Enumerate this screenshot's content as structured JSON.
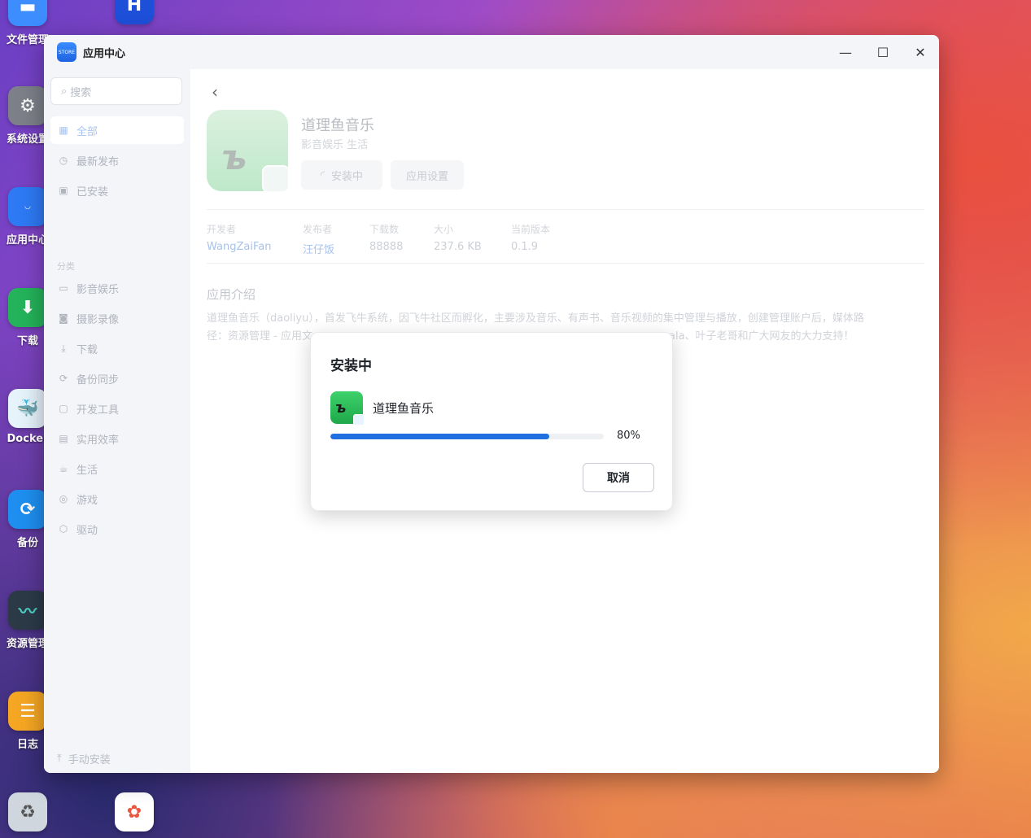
{
  "desktop": {
    "icons": [
      {
        "label": "文件管理",
        "color": "#3d8dff"
      },
      {
        "label": "系统设置",
        "color": "#7d8089"
      },
      {
        "label": "应用中心",
        "color": "#2e7af5"
      },
      {
        "label": "下载",
        "color": "#24b35a"
      },
      {
        "label": "Docker",
        "color": "#3f9ad8"
      },
      {
        "label": "备份",
        "color": "#1e8ff0"
      },
      {
        "label": "资源管理",
        "color": "#2c3a48"
      },
      {
        "label": "日志",
        "color": "#f5a623"
      },
      {
        "label": "",
        "color": "#cfd6de"
      },
      {
        "label": "",
        "color": "#ffffff"
      },
      {
        "label": "",
        "color": "#1d4fd8"
      }
    ]
  },
  "window": {
    "title": "应用中心",
    "icon_text": "STORE",
    "controls": {
      "minimize": "—",
      "maximize": "☐",
      "close": "✕"
    }
  },
  "sidebar": {
    "search_placeholder": "搜索",
    "items": [
      {
        "label": "全部",
        "icon": "grid-icon",
        "glyph": "▦"
      },
      {
        "label": "最新发布",
        "icon": "clock-icon",
        "glyph": "◷"
      },
      {
        "label": "已安装",
        "icon": "installed-icon",
        "glyph": "▣"
      }
    ],
    "category_label": "分类",
    "categories": [
      {
        "label": "影音娱乐",
        "icon": "video-icon",
        "glyph": "▭"
      },
      {
        "label": "摄影录像",
        "icon": "camera-icon",
        "glyph": "◙"
      },
      {
        "label": "下载",
        "icon": "download-icon",
        "glyph": "⤓"
      },
      {
        "label": "备份同步",
        "icon": "sync-icon",
        "glyph": "⟳"
      },
      {
        "label": "开发工具",
        "icon": "code-icon",
        "glyph": "▢"
      },
      {
        "label": "实用效率",
        "icon": "briefcase-icon",
        "glyph": "▤"
      },
      {
        "label": "生活",
        "icon": "cup-icon",
        "glyph": "☕"
      },
      {
        "label": "游戏",
        "icon": "gamepad-icon",
        "glyph": "◎"
      },
      {
        "label": "驱动",
        "icon": "cube-icon",
        "glyph": "⬡"
      }
    ],
    "manual_install": "手动安装"
  },
  "app": {
    "name": "道理鱼音乐",
    "tags": "影音娱乐 生活",
    "install_button": "安装中",
    "settings_button": "应用设置",
    "meta": {
      "developer_label": "开发者",
      "developer": "WangZaiFan",
      "publisher_label": "发布者",
      "publisher": "汪仔饭",
      "downloads_label": "下载数",
      "downloads": "88888",
      "size_label": "大小",
      "size": "237.6 KB",
      "version_label": "当前版本",
      "version": "0.1.9"
    },
    "intro_title": "应用介绍",
    "intro_text_line1": "道理鱼音乐（daoliyu），首发飞牛系统，因飞牛社区而孵化，主要涉及音乐、有声书、音乐视频的集中管理与播放，创建管理账户后，媒体路",
    "intro_text_line2": "径：资源管理 - 应用文",
    "intro_text_line2_end": "ala、叶子老哥和广大网友的大力支持！"
  },
  "dialog": {
    "title": "安装中",
    "app_name": "道理鱼音乐",
    "progress": 0.8,
    "progress_text": "80%",
    "cancel": "取消",
    "accent": "#1f6fe0"
  }
}
